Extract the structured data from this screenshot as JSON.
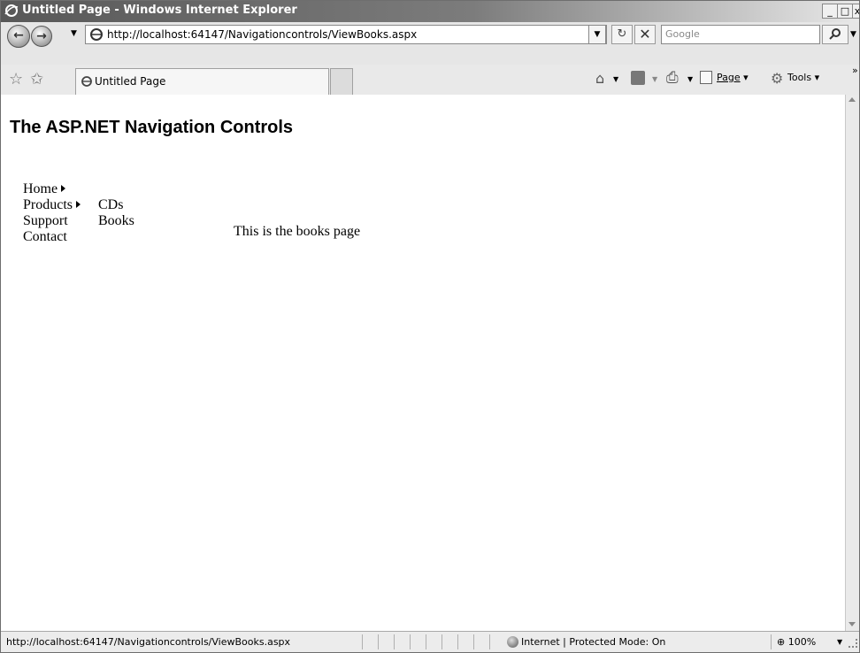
{
  "window": {
    "title": "Untitled Page - Windows Internet Explorer",
    "min_glyph": "_",
    "max_glyph": "□",
    "close_glyph": "x"
  },
  "toolbar": {
    "url": "http://localhost:64147/Navigationcontrols/ViewBooks.aspx",
    "search_placeholder": "Google",
    "back_glyph": "←",
    "forward_glyph": "→"
  },
  "tabs": [
    {
      "label": "Untitled Page"
    }
  ],
  "commands": {
    "page_label": "Page",
    "tools_label": "Tools",
    "more_glyph": "»"
  },
  "page": {
    "heading": "The ASP.NET Navigation Controls",
    "menu": [
      {
        "label": "Home",
        "has_submenu": true
      },
      {
        "label": "Products",
        "has_submenu": true
      },
      {
        "label": "Support",
        "has_submenu": false
      },
      {
        "label": "Contact",
        "has_submenu": false
      }
    ],
    "submenu": [
      {
        "label": "CDs"
      },
      {
        "label": "Books"
      }
    ],
    "body_text": "This is the books page"
  },
  "status": {
    "url": "http://localhost:64147/Navigationcontrols/ViewBooks.aspx",
    "zone": "Internet | Protected Mode: On",
    "zoom": "100%"
  },
  "icons": {
    "browser": "ie-logo-icon",
    "favorites": "star-icon",
    "add_favorite": "add-favorite-icon",
    "home": "home-icon",
    "feeds": "rss-feed-icon",
    "print": "printer-icon",
    "page": "page-icon",
    "tools": "gear-icon",
    "search": "magnifier-icon",
    "refresh": "refresh-icon",
    "stop": "stop-icon",
    "zone": "globe-icon"
  }
}
